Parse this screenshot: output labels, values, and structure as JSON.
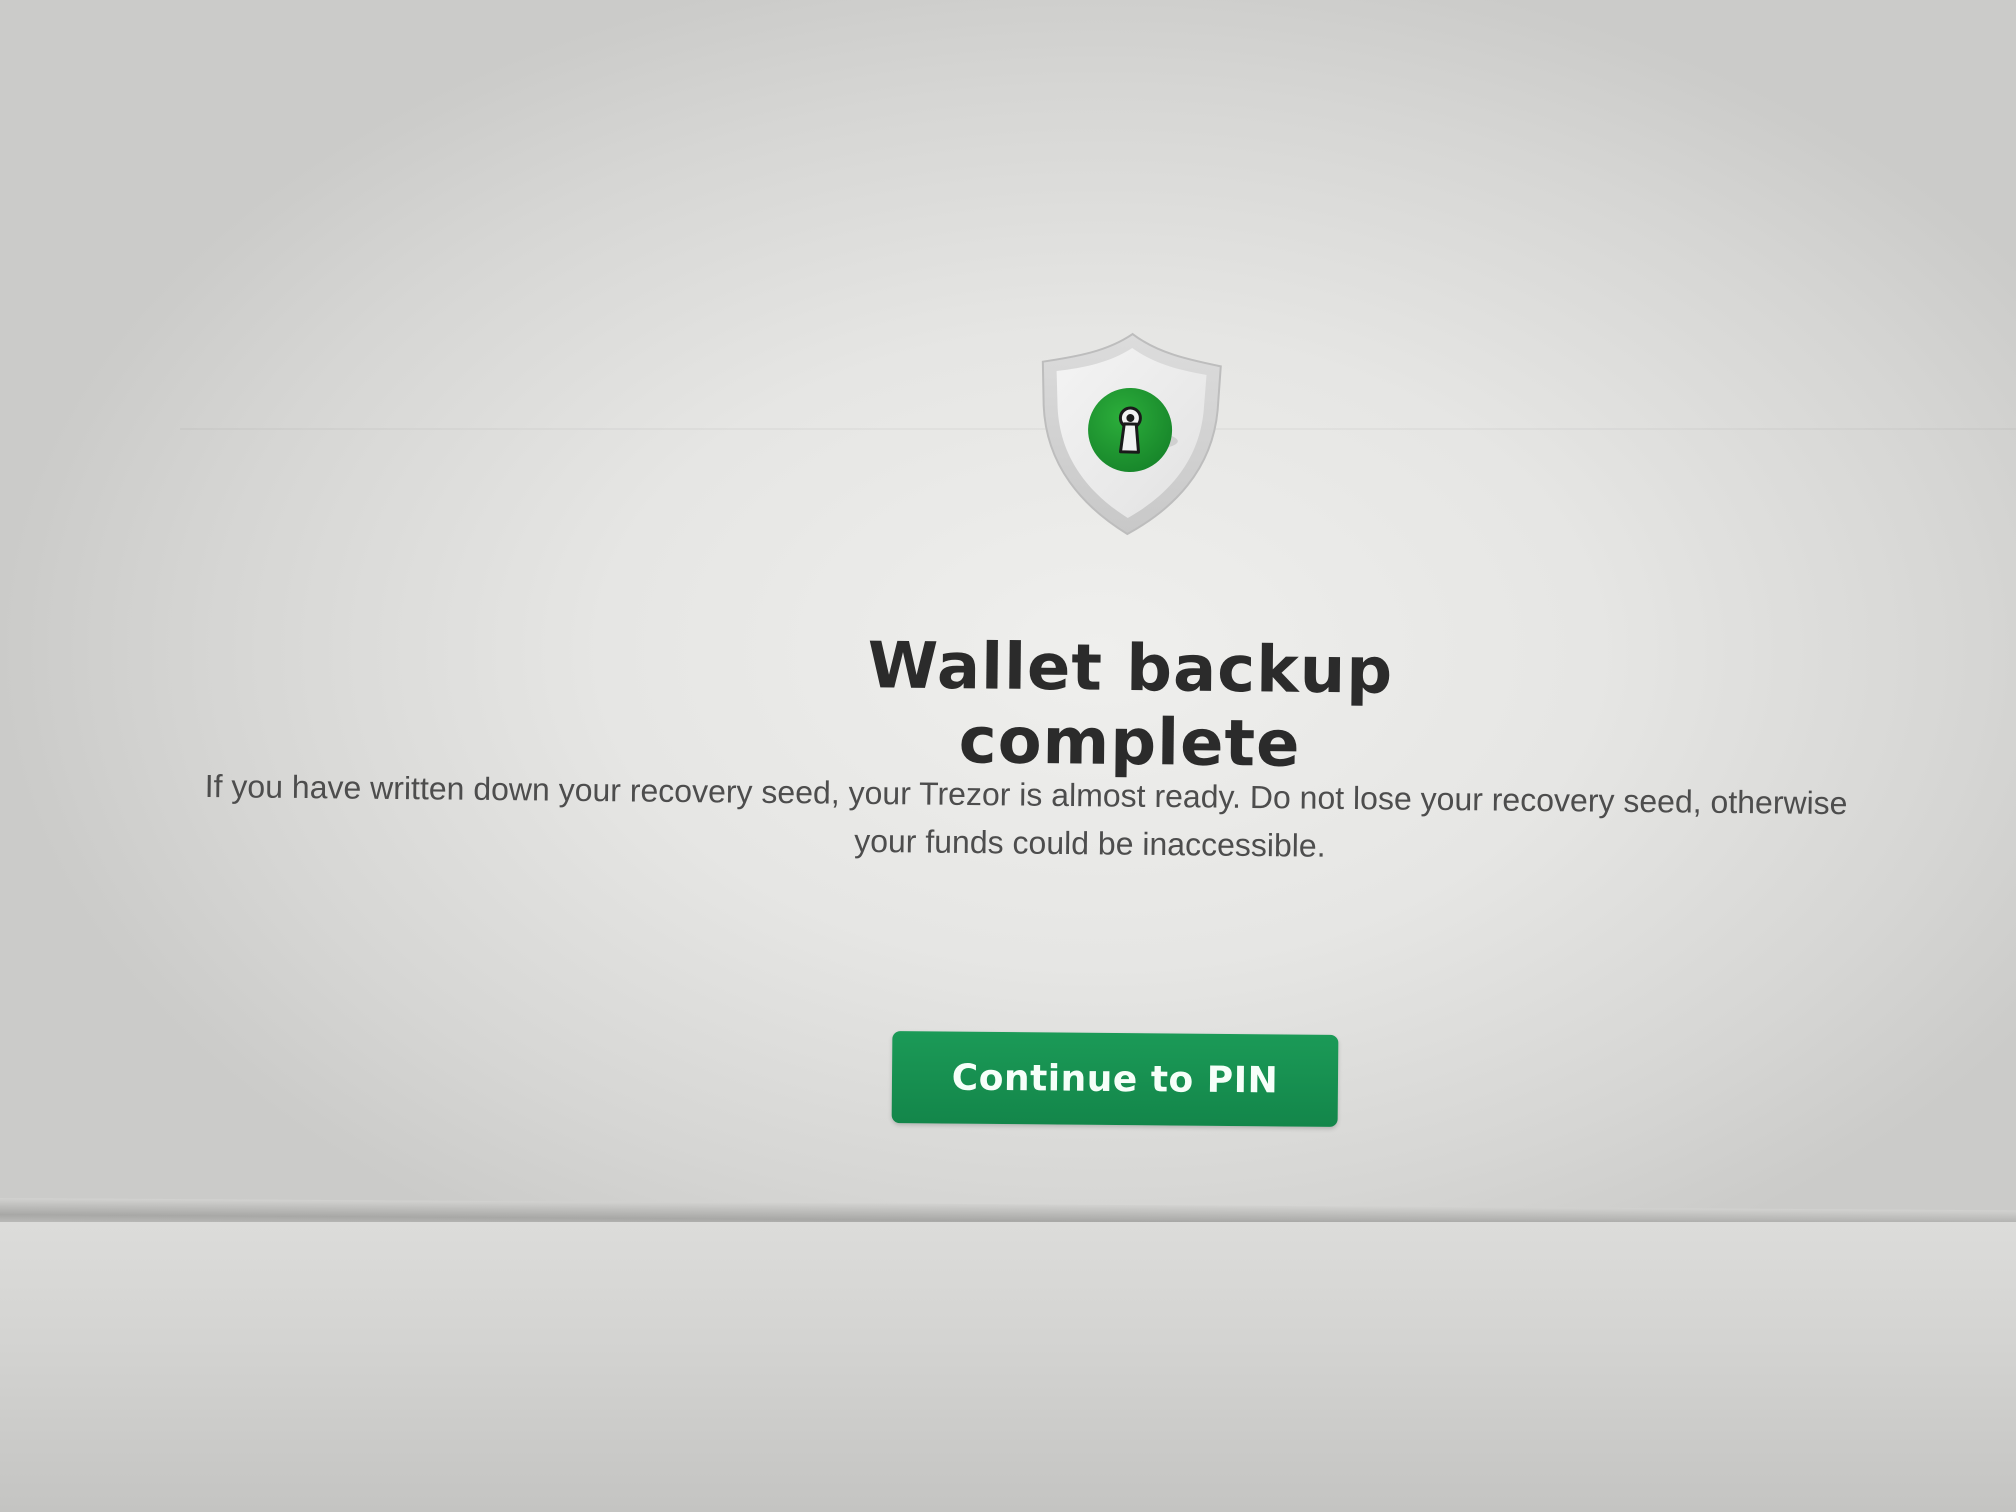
{
  "onboarding": {
    "title": "Wallet backup complete",
    "description_line1": "If you have written down your recovery seed, your Trezor is almost ready. Do not lose your recovery seed, otherwise",
    "description_line2": "your funds could be inaccessible.",
    "primary_button_label": "Continue to PIN",
    "icon": "shield-keyhole-icon"
  },
  "colors": {
    "accent_green": "#1b9a57",
    "title_text": "#2b2b2b",
    "body_text": "#4d4d4d",
    "shield_gray": "#d9d9d9"
  }
}
